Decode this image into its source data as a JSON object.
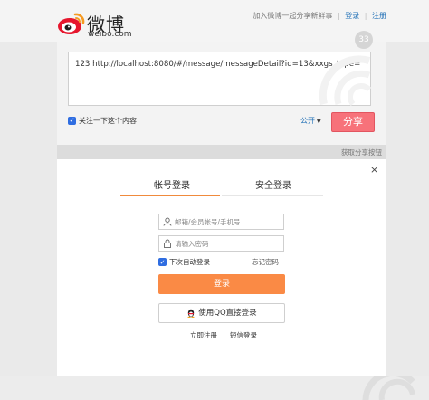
{
  "header": {
    "brand_name": "微博",
    "brand_domain": "weibo.com",
    "join_text": "加入微博一起分享新鲜事",
    "login_link": "登录",
    "register_link": "注册",
    "separator": "|"
  },
  "share": {
    "badge_count": "33",
    "text": "123 http://localhost:8080/#/message/messageDetail?id=13&xxgs_type=",
    "follow_label": "关注一下这个内容",
    "visibility_label": "公开",
    "share_button": "分享",
    "get_share_button": "获取分享按钮"
  },
  "login_modal": {
    "close_symbol": "×",
    "tabs": [
      {
        "label": "帐号登录",
        "active": true
      },
      {
        "label": "安全登录",
        "active": false
      }
    ],
    "account_placeholder": "邮箱/会员帐号/手机号",
    "password_placeholder": "请输入密码",
    "remember_label": "下次自动登录",
    "forgot_link": "忘记密码",
    "login_button": "登录",
    "qq_button": "使用QQ直接登录",
    "register_link": "立即注册",
    "sms_link": "短信登录",
    "accent_color": "#fa8a45"
  }
}
